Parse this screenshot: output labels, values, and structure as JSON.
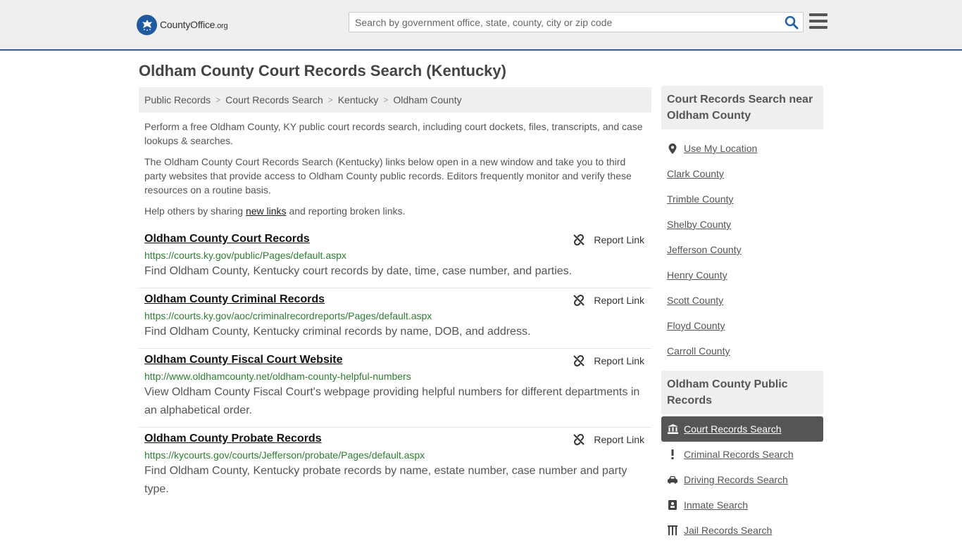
{
  "header": {
    "logo_main": "CountyOffice",
    "logo_tld": ".org",
    "search_placeholder": "Search by government office, state, county, city or zip code"
  },
  "page": {
    "title": "Oldham County Court Records Search (Kentucky)"
  },
  "breadcrumb": [
    "Public Records",
    "Court Records Search",
    "Kentucky",
    "Oldham County"
  ],
  "intro": {
    "p1": "Perform a free Oldham County, KY public court records search, including court dockets, files, transcripts, and case lookups & searches.",
    "p2": "The Oldham County Court Records Search (Kentucky) links below open in a new window and take you to third party websites that provide access to Oldham County public records. Editors frequently monitor and verify these resources on a routine basis.",
    "p3_before": "Help others by sharing ",
    "p3_link": "new links",
    "p3_after": " and reporting broken links."
  },
  "report_label": "Report Link",
  "records": [
    {
      "title": "Oldham County Court Records",
      "url": "https://courts.ky.gov/public/Pages/default.aspx",
      "desc": "Find Oldham County, Kentucky court records by date, time, case number, and parties."
    },
    {
      "title": "Oldham County Criminal Records",
      "url": "https://courts.ky.gov/aoc/criminalrecordreports/Pages/default.aspx",
      "desc": "Find Oldham County, Kentucky criminal records by name, DOB, and address."
    },
    {
      "title": "Oldham County Fiscal Court Website",
      "url": "http://www.oldhamcounty.net/oldham-county-helpful-numbers",
      "desc": "View Oldham County Fiscal Court's webpage providing helpful numbers for different departments in an alphabetical order."
    },
    {
      "title": "Oldham County Probate Records",
      "url": "https://kycourts.gov/courts/Jefferson/probate/Pages/default.aspx",
      "desc": "Find Oldham County, Kentucky probate records by name, estate number, case number and party type."
    }
  ],
  "sidebar": {
    "nearby_heading": "Court Records Search near Oldham County",
    "use_location": "Use My Location",
    "nearby": [
      "Clark County",
      "Trimble County",
      "Shelby County",
      "Jefferson County",
      "Henry County",
      "Scott County",
      "Floyd County",
      "Carroll County"
    ],
    "public_heading": "Oldham County Public Records",
    "public_links": [
      {
        "label": "Court Records Search",
        "icon": "courthouse-icon",
        "active": true
      },
      {
        "label": "Criminal Records Search",
        "icon": "exclamation-icon",
        "active": false
      },
      {
        "label": "Driving Records Search",
        "icon": "car-icon",
        "active": false
      },
      {
        "label": "Inmate Search",
        "icon": "id-card-icon",
        "active": false
      },
      {
        "label": "Jail Records Search",
        "icon": "jail-icon",
        "active": false
      }
    ]
  },
  "colors": {
    "accent": "#1f64a8",
    "url_green": "#2e7d32",
    "active_bg": "#555555"
  }
}
